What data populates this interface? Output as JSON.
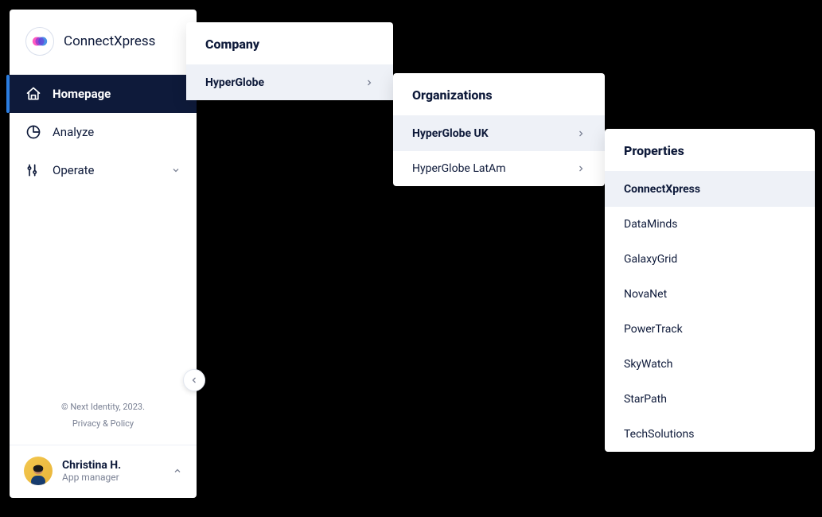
{
  "brand": {
    "name": "ConnectXpress"
  },
  "sidebar": {
    "items": [
      {
        "label": "Homepage"
      },
      {
        "label": "Analyze"
      },
      {
        "label": "Operate"
      }
    ]
  },
  "footer": {
    "copyright": "© Next Identity, 2023.",
    "privacy": "Privacy & Policy"
  },
  "user": {
    "name": "Christina H.",
    "role": "App manager"
  },
  "flyout": {
    "company": {
      "title": "Company",
      "items": [
        {
          "label": "HyperGlobe",
          "selected": true
        }
      ]
    },
    "organizations": {
      "title": "Organizations",
      "items": [
        {
          "label": "HyperGlobe UK",
          "selected": true
        },
        {
          "label": "HyperGlobe LatAm",
          "selected": false
        }
      ]
    },
    "properties": {
      "title": "Properties",
      "items": [
        {
          "label": "ConnectXpress",
          "selected": true
        },
        {
          "label": "DataMinds",
          "selected": false
        },
        {
          "label": "GalaxyGrid",
          "selected": false
        },
        {
          "label": "NovaNet",
          "selected": false
        },
        {
          "label": "PowerTrack",
          "selected": false
        },
        {
          "label": "SkyWatch",
          "selected": false
        },
        {
          "label": "StarPath",
          "selected": false
        },
        {
          "label": "TechSolutions",
          "selected": false
        }
      ]
    }
  }
}
